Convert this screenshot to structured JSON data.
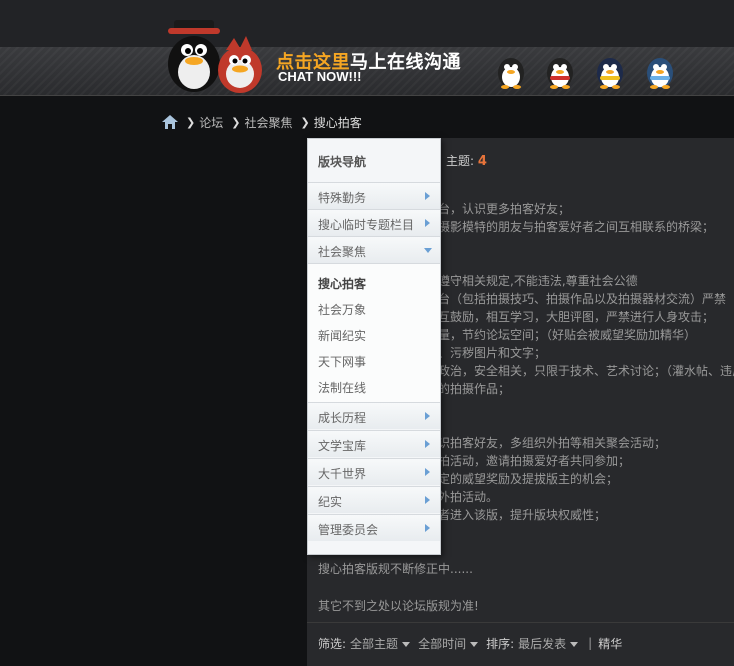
{
  "banner": {
    "chat_cn_highlight": "点击这里",
    "chat_cn_rest": "马上在线沟通",
    "chat_en": "CHAT NOW!!!"
  },
  "breadcrumb": {
    "items": [
      "论坛",
      "社会聚焦",
      "搜心拍客"
    ]
  },
  "header": {
    "topics_label": "主题:",
    "topics_count": "4"
  },
  "content": {
    "lines": [
      "台，认识更多拍客好友；",
      "摄影模特的朋友与拍客爱好者之间互相联系的桥梁；",
      "遵守相关规定,不能违法,尊重社会公德",
      "台（包括拍摄技巧、拍摄作品以及拍摄器材交流）严禁",
      "互鼓励，相互学习，大胆评图，严禁进行人身攻击；",
      "量，节约论坛空间；（好贴会被威望奖励加精华）",
      "、污秽图片和文字；",
      "政治，安全相关，只限于技术、艺术讨论；（灌水帖、违反",
      "的拍摄作品；",
      "识拍客好友，多组织外拍等相关聚会活动；",
      "拍活动，邀请拍摄爱好者共同参加；",
      "定的威望奖励及提拔版主的机会；",
      "外拍活动。",
      "者进入该版，提升版块权威性；",
      "搜心拍客版规不断修正中......",
      "其它不到之处以论坛版规为准!"
    ]
  },
  "filter": {
    "filter_label": "筛选:",
    "all_topics": "全部主题",
    "all_time": "全部时间",
    "sort_label": "排序:",
    "latest": "最后发表",
    "sep": "|",
    "digest": "精华"
  },
  "nav": {
    "title": "版块导航",
    "rows_top": [
      "特殊勤务",
      "搜心临时专题栏目",
      "社会聚焦"
    ],
    "sub_items": [
      "搜心拍客",
      "社会万象",
      "新闻纪实",
      "天下网事",
      "法制在线"
    ],
    "rows_bottom": [
      "成长历程",
      "文学宝库",
      "大千世界",
      "纪实",
      "管理委员会"
    ]
  },
  "colors": {
    "accent_count": "#e8743b",
    "arrow_blue": "#6a9fd4"
  }
}
